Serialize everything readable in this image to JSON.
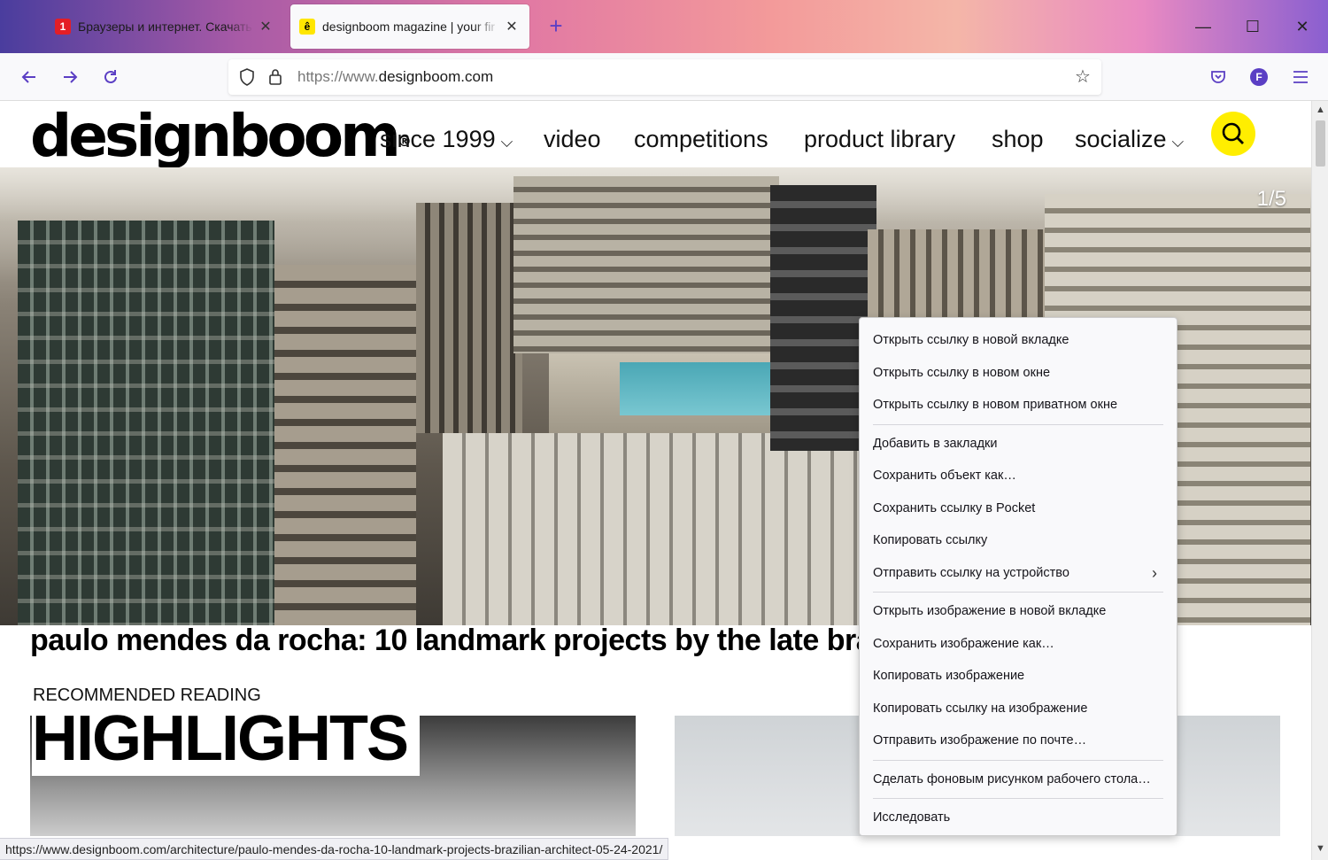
{
  "tabs": [
    {
      "title": "Браузеры и интернет. Скачать",
      "favicon": "softportal-icon",
      "favicon_color": "#e41e26",
      "favicon_glyph": "1"
    },
    {
      "title": "designboom magazine | your fir",
      "favicon": "designboom-icon",
      "favicon_color": "#ffe600",
      "favicon_glyph": "ê"
    }
  ],
  "window": {
    "minimize": "—",
    "maximize": "☐",
    "close": "✕"
  },
  "toolbar": {
    "url_prefix": "https://www.",
    "url_host": "designboom.com",
    "profile_initial": "F"
  },
  "site": {
    "logo": "designboom",
    "logo_mark": "®",
    "nav": [
      {
        "label": "since 1999",
        "has_dropdown": true
      },
      {
        "label": "video",
        "has_dropdown": false
      },
      {
        "label": "competitions",
        "has_dropdown": false
      },
      {
        "label": "product library",
        "has_dropdown": false
      },
      {
        "label": "shop",
        "has_dropdown": false
      },
      {
        "label": "socialize",
        "has_dropdown": true
      }
    ],
    "slide_counter": "1/5",
    "headline": "paulo mendes da rocha: 10 landmark projects by the late brazi",
    "recommended_label": "RECOMMENDED READING",
    "highlights_label": "HIGHLIGHTS"
  },
  "status_url": "https://www.designboom.com/architecture/paulo-mendes-da-rocha-10-landmark-projects-brazilian-architect-05-24-2021/",
  "context_menu": {
    "groups": [
      [
        "Открыть ссылку в новой вкладке",
        "Открыть ссылку в новом окне",
        "Открыть ссылку в новом приватном окне"
      ],
      [
        "Добавить в закладки",
        "Сохранить объект как…",
        "Сохранить ссылку в Pocket",
        "Копировать ссылку",
        "Отправить ссылку на устройство"
      ],
      [
        "Открыть изображение в новой вкладке",
        "Сохранить изображение как…",
        "Копировать изображение",
        "Копировать ссылку на изображение",
        "Отправить изображение по почте…"
      ],
      [
        "Сделать фоновым рисунком рабочего стола…"
      ],
      [
        "Исследовать"
      ]
    ]
  },
  "colors": {
    "accent": "#5b3fc4",
    "search_button": "#ffee00"
  }
}
